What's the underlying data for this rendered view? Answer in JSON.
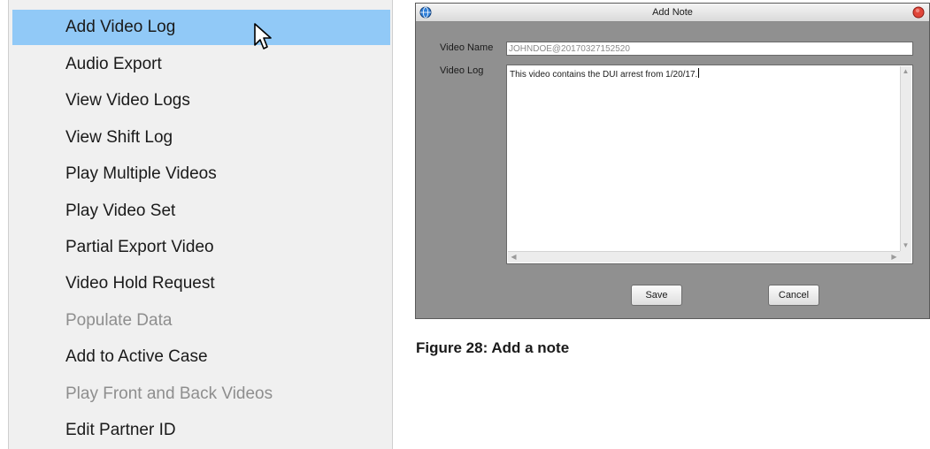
{
  "context_menu": {
    "items": [
      {
        "label": "Add Video Log",
        "state": "highlighted"
      },
      {
        "label": "Audio Export",
        "state": "enabled"
      },
      {
        "label": "View Video Logs",
        "state": "enabled"
      },
      {
        "label": "View Shift Log",
        "state": "enabled"
      },
      {
        "label": "Play Multiple Videos",
        "state": "enabled"
      },
      {
        "label": "Play Video Set",
        "state": "enabled"
      },
      {
        "label": "Partial Export Video",
        "state": "enabled"
      },
      {
        "label": "Video Hold Request",
        "state": "enabled"
      },
      {
        "label": "Populate Data",
        "state": "disabled"
      },
      {
        "label": "Add to Active Case",
        "state": "enabled"
      },
      {
        "label": "Play Front and Back Videos",
        "state": "disabled"
      },
      {
        "label": "Edit Partner ID",
        "state": "enabled"
      }
    ],
    "highlight_color": "#91c9f7",
    "cursor_icon": "mouse-pointer-icon"
  },
  "dialog": {
    "title": "Add Note",
    "app_icon": "globe-icon",
    "close_icon": "close-icon",
    "video_name_label": "Video Name",
    "video_name_value": "JOHNDOE@20170327152520",
    "video_log_label": "Video Log",
    "video_log_value": "This video contains the DUI arrest from 1/20/17.",
    "save_label": "Save",
    "cancel_label": "Cancel"
  },
  "caption": "Figure 28: Add a note"
}
